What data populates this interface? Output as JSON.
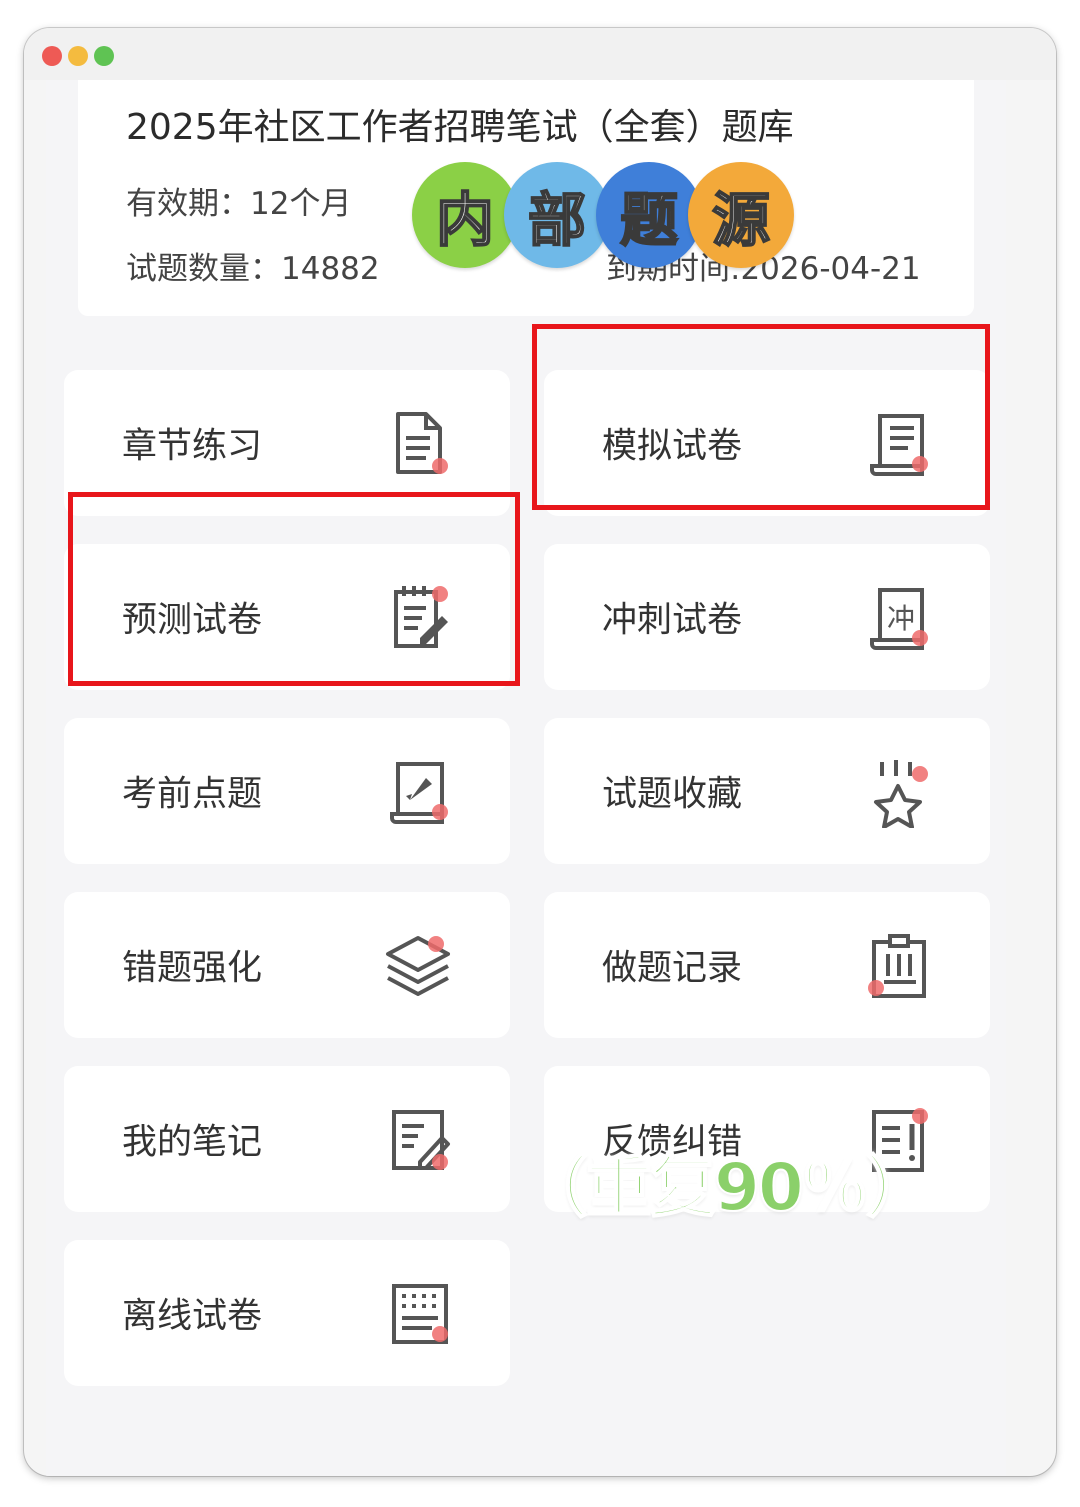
{
  "colors": {
    "highlight": "#e8161b",
    "icon_stroke": "#555555",
    "icon_accent": "#ef6b6b",
    "overlay_green": "#8bd06a",
    "badge_colors": [
      "#8bd046",
      "#6fb9e8",
      "#3f7fd9",
      "#f3a93a"
    ]
  },
  "window": {
    "controls": [
      "close",
      "minimize",
      "maximize"
    ]
  },
  "info": {
    "title": "2025年社区工作者招聘笔试（全套）题库",
    "validity": "有效期：12个月",
    "count": "试题数量：14882",
    "expiry": "到期时间:2026-04-21"
  },
  "sticker": {
    "chars": [
      "内",
      "部",
      "题",
      "源"
    ]
  },
  "tiles": [
    {
      "label": "章节练习",
      "icon": "document-lines-icon"
    },
    {
      "label": "模拟试卷",
      "icon": "scroll-paper-icon"
    },
    {
      "label": "预测试卷",
      "icon": "notepad-pen-icon"
    },
    {
      "label": "冲刺试卷",
      "icon": "sprint-scroll-icon"
    },
    {
      "label": "考前点题",
      "icon": "rocket-board-icon"
    },
    {
      "label": "试题收藏",
      "icon": "star-sparkle-icon"
    },
    {
      "label": "错题强化",
      "icon": "layers-icon"
    },
    {
      "label": "做题记录",
      "icon": "clipboard-icon"
    },
    {
      "label": "我的笔记",
      "icon": "note-edit-icon"
    },
    {
      "label": "反馈纠错",
      "icon": "feedback-alert-icon"
    },
    {
      "label": "离线试卷",
      "icon": "offline-grid-icon"
    }
  ],
  "overlay": {
    "text": "（重复90％）"
  }
}
